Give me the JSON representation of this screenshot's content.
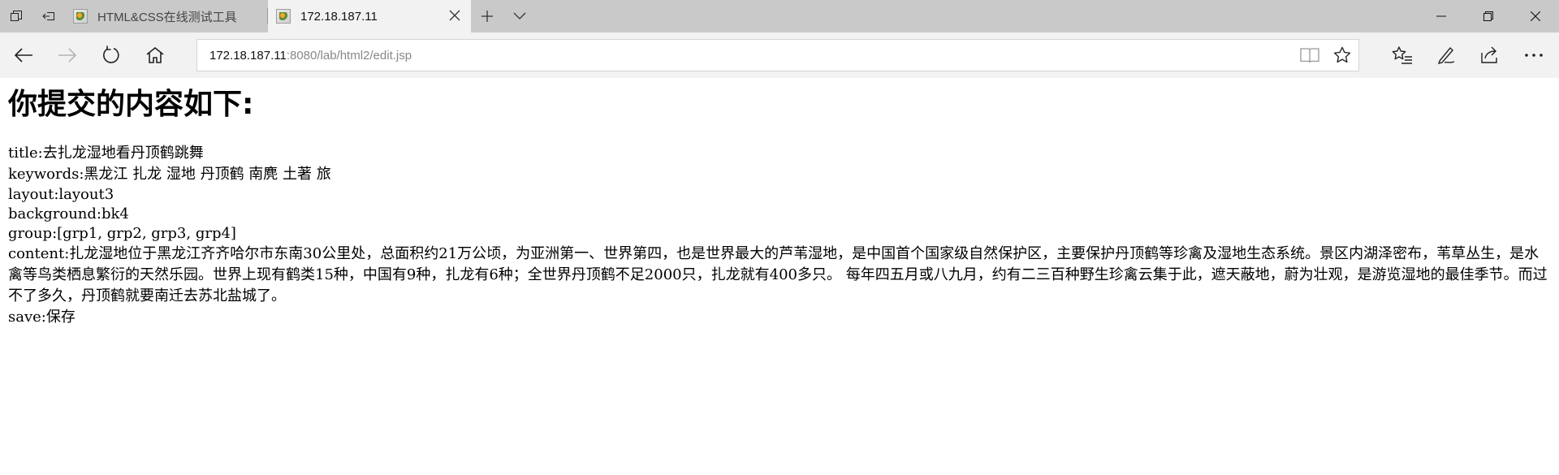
{
  "browser": {
    "tabs": [
      {
        "label": "HTML&CSS在线测试工具",
        "active": false
      },
      {
        "label": "172.18.187.11",
        "active": true
      }
    ],
    "address": {
      "host": "172.18.187.11",
      "path": ":8080/lab/html2/edit.jsp"
    },
    "icons": {
      "tab_actions": "tab-actions-icon",
      "set_aside": "set-aside-tabs-icon",
      "close_tab": "close-icon",
      "new_tab": "plus-icon",
      "tab_preview": "chevron-down-icon",
      "minimize": "minimize-icon",
      "maximize": "restore-icon",
      "close_window": "close-window-icon",
      "back": "back-arrow-icon",
      "forward": "forward-arrow-icon",
      "refresh": "refresh-icon",
      "home": "home-icon",
      "reading_view": "reading-view-icon",
      "favorite": "star-icon",
      "favorites_hub": "favorites-hub-icon",
      "web_note": "pen-icon",
      "share": "share-icon",
      "more": "more-icon"
    }
  },
  "page": {
    "heading": "你提交的内容如下:",
    "fields": [
      {
        "label": "title:",
        "value": "去扎龙湿地看丹顶鹤跳舞"
      },
      {
        "label": "keywords:",
        "value": "黑龙江 扎龙 湿地 丹顶鹤 南麂 土著 旅"
      },
      {
        "label": "layout:",
        "value": "layout3"
      },
      {
        "label": "background:",
        "value": "bk4"
      },
      {
        "label": "group:",
        "value": "[grp1, grp2, grp3, grp4]"
      },
      {
        "label": "content:",
        "value": "扎龙湿地位于黑龙江齐齐哈尔市东南30公里处，总面积约21万公顷，为亚洲第一、世界第四，也是世界最大的芦苇湿地，是中国首个国家级自然保护区，主要保护丹顶鹤等珍禽及湿地生态系统。景区内湖泽密布，苇草丛生，是水禽等鸟类栖息繁衍的天然乐园。世界上现有鹤类15种，中国有9种，扎龙有6种；全世界丹顶鹤不足2000只，扎龙就有400多只。 每年四五月或八九月，约有二三百种野生珍禽云集于此，遮天蔽地，蔚为壮观，是游览湿地的最佳季节。而过不了多久，丹顶鹤就要南迁去苏北盐城了。"
      },
      {
        "label": "save:",
        "value": "保存"
      }
    ]
  }
}
